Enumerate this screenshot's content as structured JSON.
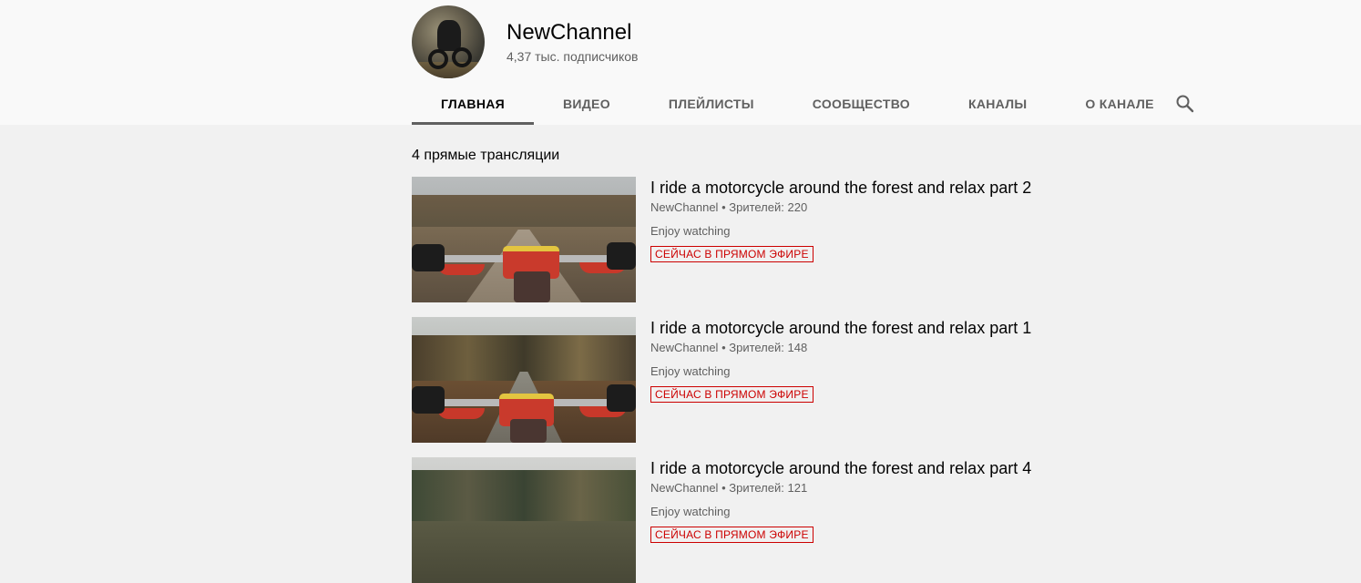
{
  "channel": {
    "name": "NewChannel",
    "subscribers": "4,37 тыс. подписчиков"
  },
  "tabs": [
    {
      "label": "ГЛАВНАЯ",
      "active": true
    },
    {
      "label": "ВИДЕО",
      "active": false
    },
    {
      "label": "ПЛЕЙЛИСТЫ",
      "active": false
    },
    {
      "label": "СООБЩЕСТВО",
      "active": false
    },
    {
      "label": "КАНАЛЫ",
      "active": false
    },
    {
      "label": "О КАНАЛЕ",
      "active": false
    }
  ],
  "search_icon": "search-icon",
  "section": {
    "title": "4 прямые трансляции"
  },
  "videos": [
    {
      "title": "I ride a motorcycle around the forest and relax part 2",
      "channel": "NewChannel",
      "viewers": "Зрителей: 220",
      "description": "Enjoy watching",
      "badge": "СЕЙЧАС В ПРЯМОМ ЭФИРЕ"
    },
    {
      "title": "I ride a motorcycle around the forest and relax part 1",
      "channel": "NewChannel",
      "viewers": "Зрителей: 148",
      "description": "Enjoy watching",
      "badge": "СЕЙЧАС В ПРЯМОМ ЭФИРЕ"
    },
    {
      "title": "I ride a motorcycle around the forest and relax part 4",
      "channel": "NewChannel",
      "viewers": "Зрителей: 121",
      "description": "Enjoy watching",
      "badge": "СЕЙЧАС В ПРЯМОМ ЭФИРЕ"
    }
  ],
  "colors": {
    "header_bg": "#f9f9f9",
    "page_bg": "#f1f1f1",
    "live_red": "#cc0000",
    "secondary_text": "#606060"
  }
}
